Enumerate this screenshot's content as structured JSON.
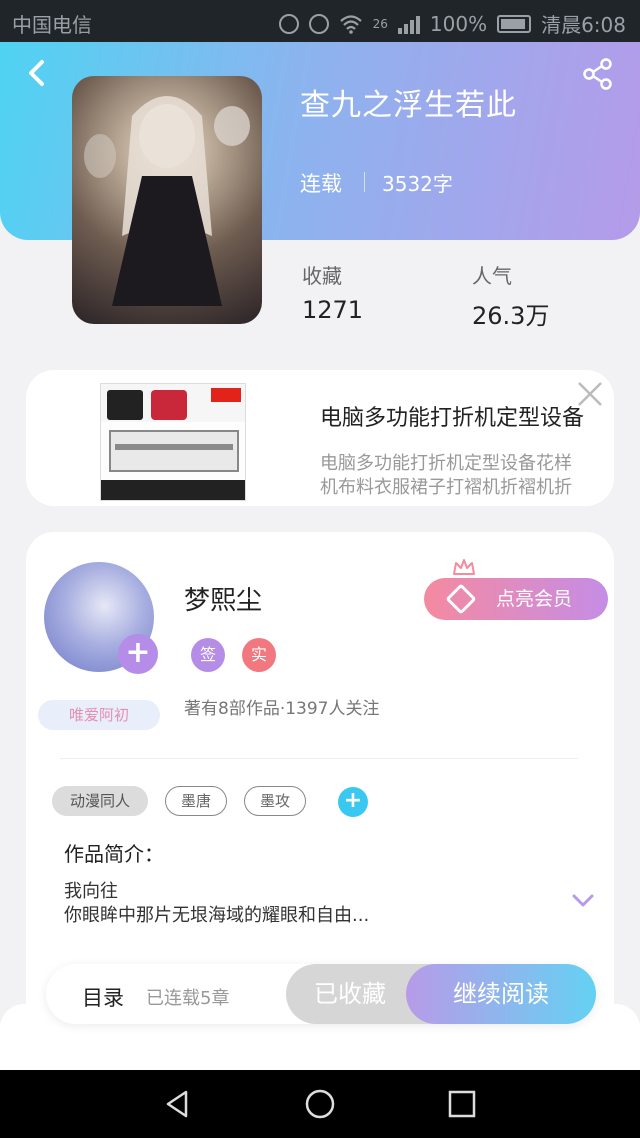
{
  "status_bar": {
    "carrier": "中国电信",
    "network": "26",
    "battery": "100%",
    "time": "清晨6:08"
  },
  "book": {
    "title": "查九之浮生若此",
    "status": "连载",
    "word_count": "3532字",
    "stats": [
      {
        "label": "收藏",
        "value": "1271"
      },
      {
        "label": "人气",
        "value": "26.3万"
      }
    ]
  },
  "ad": {
    "title": "电脑多功能打折机定型设备",
    "description_line1": "电脑多功能打折机定型设备花样",
    "description_line2": "机布料衣服裙子打褶机折褶机折"
  },
  "author": {
    "name": "梦熙尘",
    "fan_badge": "唯爱阿初",
    "badge_sign": "签",
    "badge_real": "实",
    "stats": "著有8部作品·1397人关注",
    "vip_button": "点亮会员"
  },
  "tags": [
    "动漫同人",
    "墨唐",
    "墨攻"
  ],
  "intro": {
    "label": "作品简介：",
    "line1": "我向往",
    "line2": "你眼眸中那片无垠海域的耀眼和自由..."
  },
  "bottom_bar": {
    "toc": "目录",
    "toc_sub": "已连载5章",
    "collected": "已收藏",
    "continue": "继续阅读"
  },
  "colors": {
    "header_start": "#4fd3f2",
    "header_end": "#b59be9",
    "vip_pink": "#f58aa0",
    "accent_blue": "#3bc8f0"
  }
}
